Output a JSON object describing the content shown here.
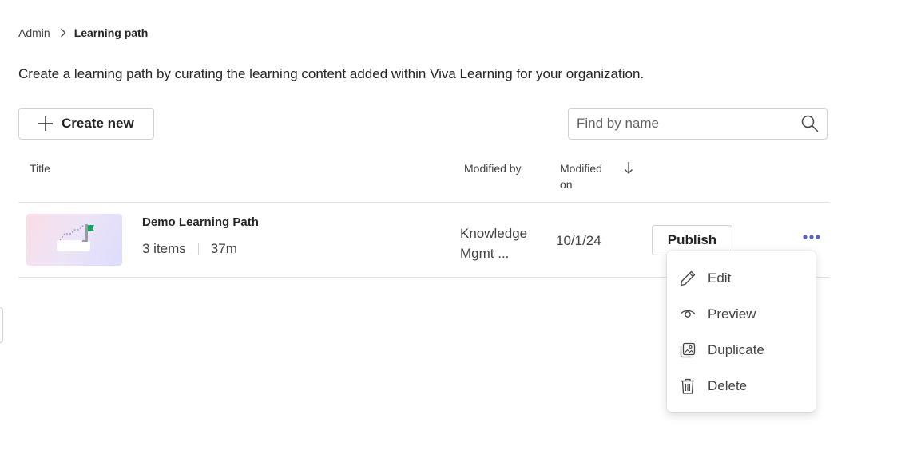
{
  "breadcrumb": {
    "root": "Admin",
    "current": "Learning path"
  },
  "description": "Create a learning path by curating the learning content added within Viva Learning for your organization.",
  "toolbar": {
    "create_label": "Create new"
  },
  "search": {
    "placeholder": "Find by name",
    "value": ""
  },
  "table": {
    "headers": {
      "title": "Title",
      "modified_by": "Modified by",
      "modified_on": "Modified on"
    },
    "rows": [
      {
        "title": "Demo Learning Path",
        "items": "3 items",
        "duration": "37m",
        "modified_by": "Knowledge Mgmt ...",
        "modified_on": "10/1/24",
        "action": "Publish"
      }
    ]
  },
  "menu": {
    "items": [
      {
        "label": "Edit",
        "icon": "pencil-icon"
      },
      {
        "label": "Preview",
        "icon": "eye-icon"
      },
      {
        "label": "Duplicate",
        "icon": "duplicate-icon"
      },
      {
        "label": "Delete",
        "icon": "trash-icon"
      }
    ]
  },
  "colors": {
    "accent": "#5b5fc7",
    "border": "#d1d1d1",
    "text": "#242424"
  }
}
